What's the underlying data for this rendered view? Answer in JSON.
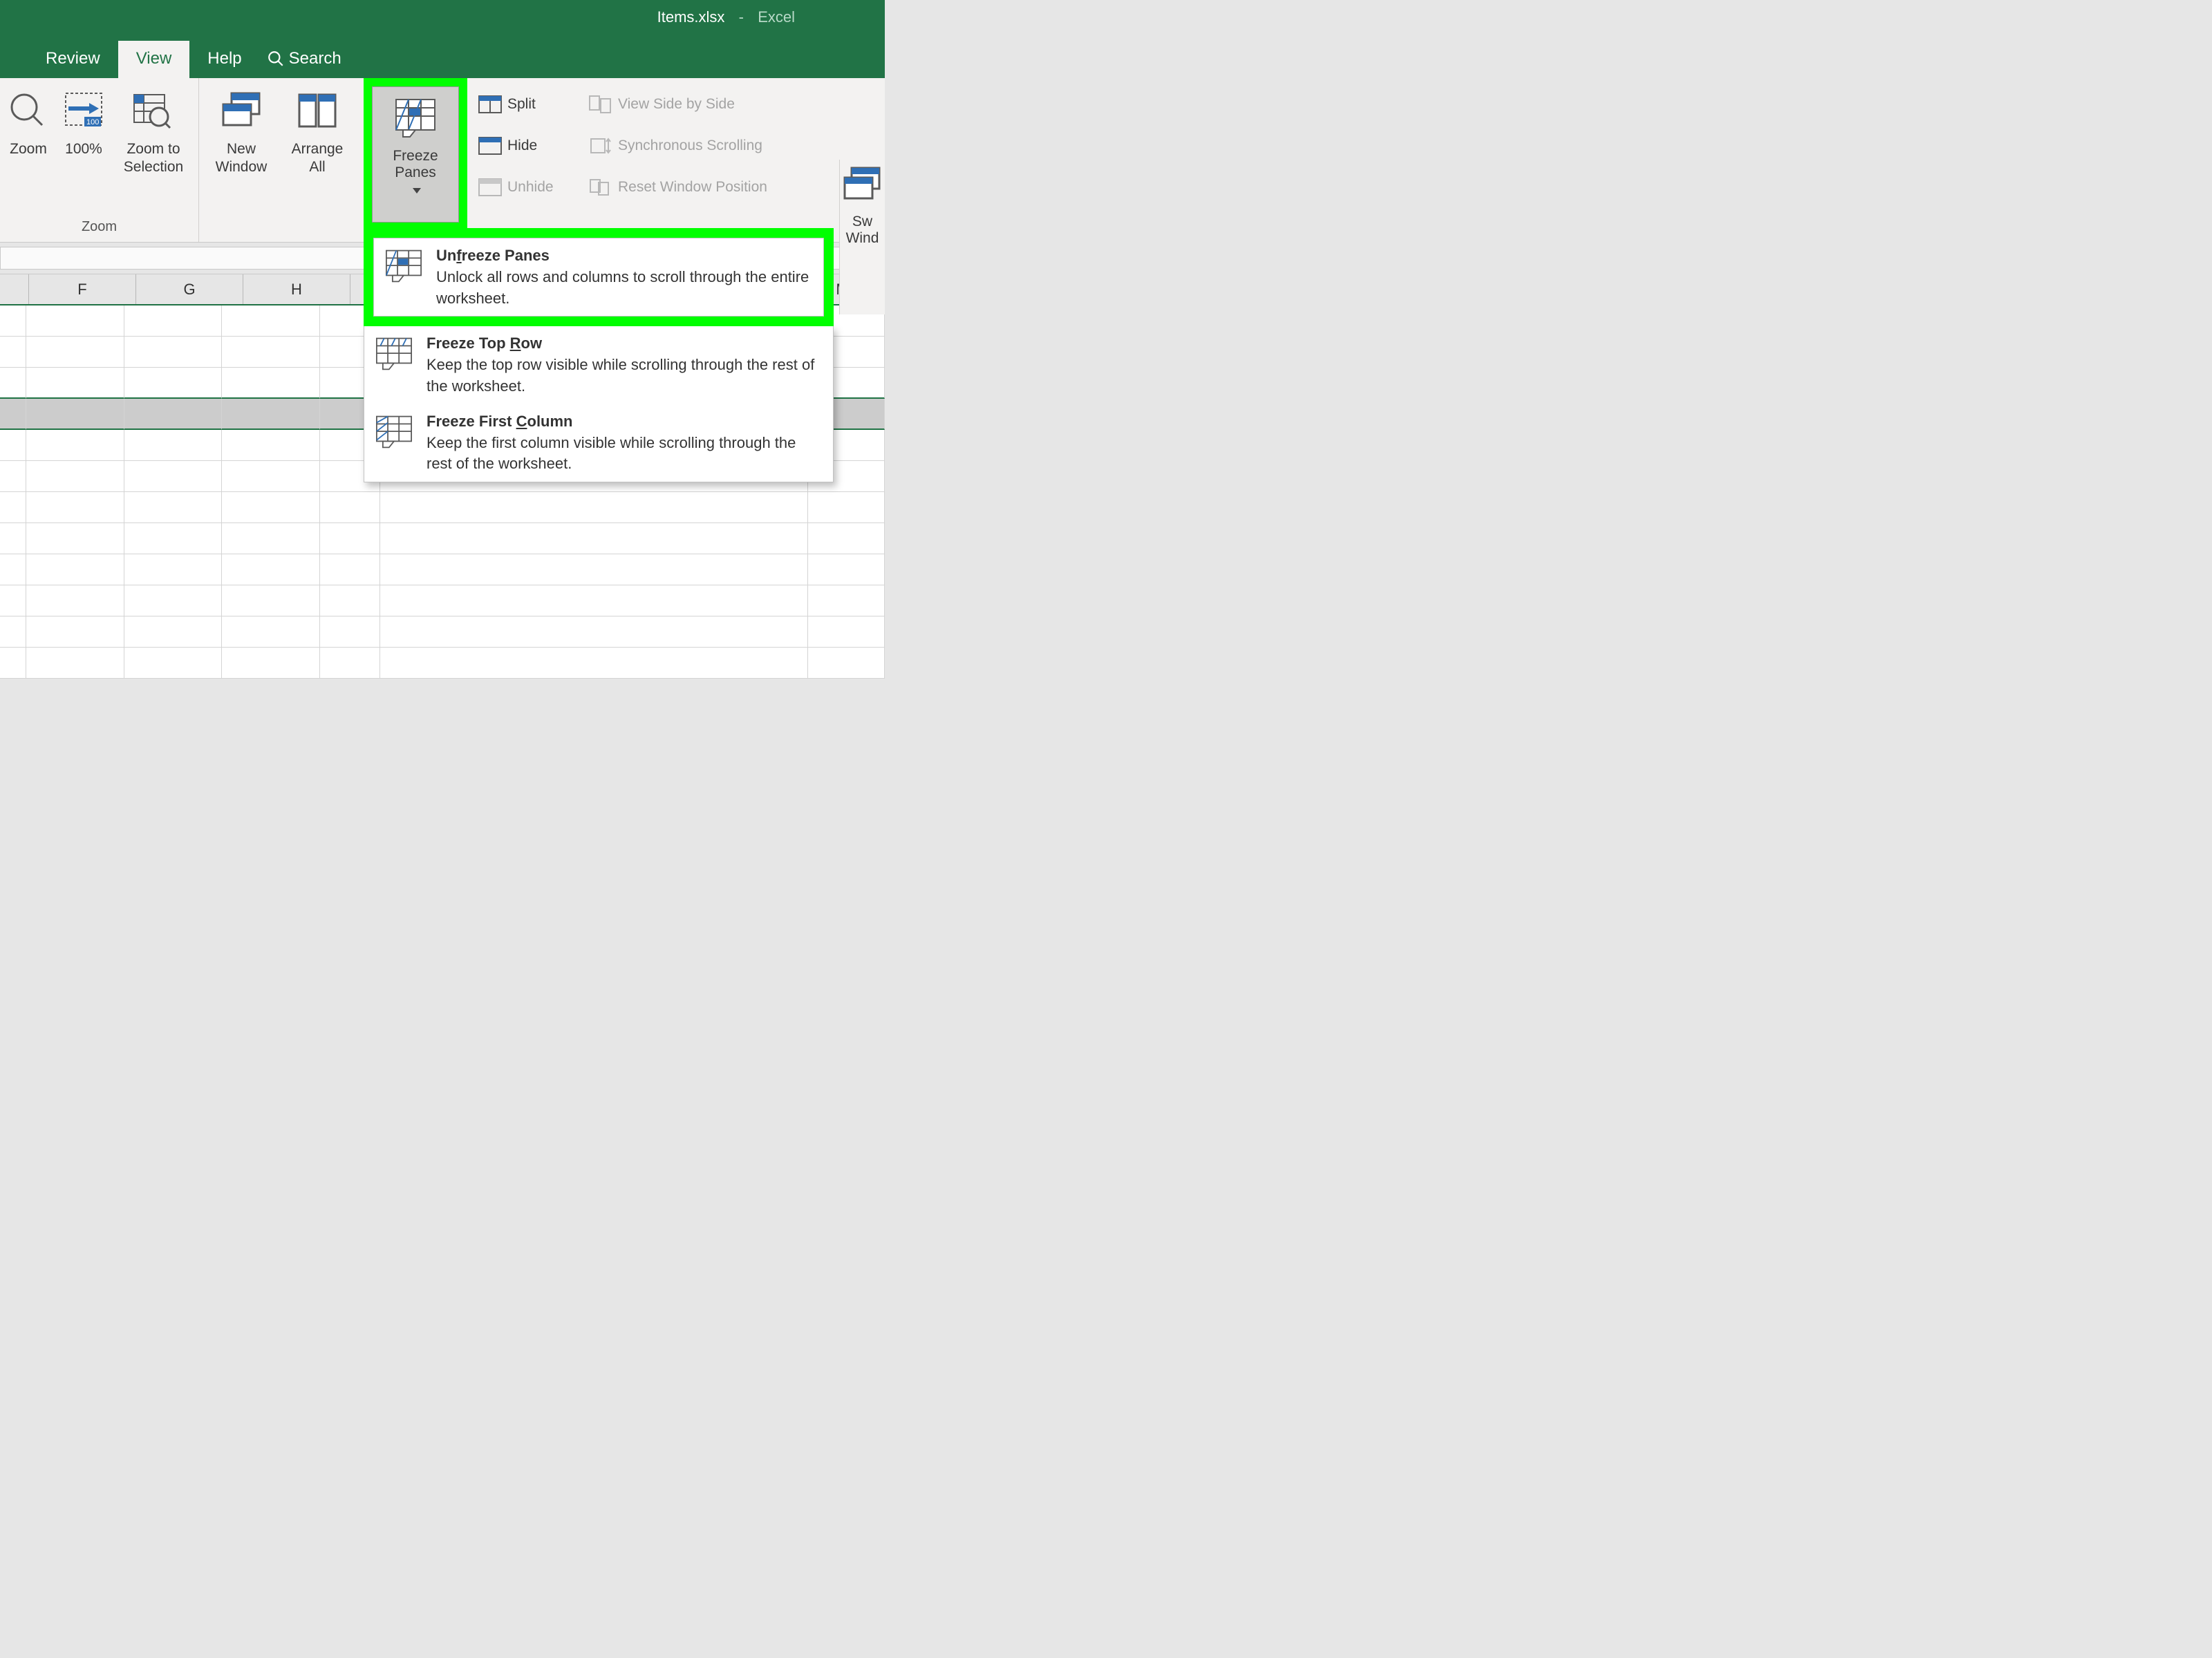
{
  "title": {
    "filename": "Items.xlsx",
    "sep": "-",
    "app": "Excel"
  },
  "tabs": {
    "review": "Review",
    "view": "View",
    "help": "Help",
    "search": "Search"
  },
  "ribbon": {
    "zoom": {
      "label": "Zoom",
      "zoom": "Zoom",
      "hundred": "100%",
      "zoom_to_selection": "Zoom to\nSelection"
    },
    "window": {
      "new_window": "New\nWindow",
      "arrange_all": "Arrange\nAll",
      "freeze_panes": "Freeze\nPanes",
      "split": "Split",
      "hide": "Hide",
      "unhide": "Unhide",
      "side_by_side": "View Side by Side",
      "sync_scroll": "Synchronous Scrolling",
      "reset_pos": "Reset Window Position",
      "switch_windows": "Switch\nWindows"
    }
  },
  "freeze_menu": {
    "unfreeze": {
      "title_pre": "Un",
      "title_u": "f",
      "title_post": "reeze Panes",
      "desc": "Unlock all rows and columns to scroll through the entire worksheet."
    },
    "top_row": {
      "title_pre": "Freeze Top ",
      "title_u": "R",
      "title_post": "ow",
      "desc": "Keep the top row visible while scrolling through the rest of the worksheet."
    },
    "first_col": {
      "title_pre": "Freeze First ",
      "title_u": "C",
      "title_post": "olumn",
      "desc": "Keep the first column visible while scrolling through the rest of the worksheet."
    }
  },
  "columns": {
    "F": "F",
    "G": "G",
    "H": "H",
    "M": "M"
  },
  "switch_label_1": "Sw",
  "switch_label_2": "Wind"
}
